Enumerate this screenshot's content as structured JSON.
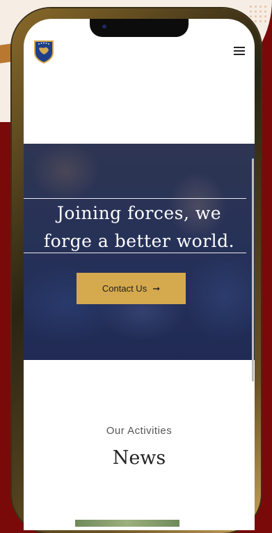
{
  "header": {
    "logo_icon": "kosovo-shield-logo",
    "menu_icon": "hamburger-menu-icon"
  },
  "hero": {
    "title_line1": "Joining forces, we",
    "title_line2": "forge a better world.",
    "cta_label": "Contact Us",
    "cta_icon": "arrow-right-icon"
  },
  "section": {
    "kicker": "Our Activities",
    "title": "News"
  },
  "colors": {
    "accent": "#d5a94e",
    "background": "#7a0a0a",
    "logo_blue": "#214a93",
    "logo_gold": "#d5a94e"
  }
}
